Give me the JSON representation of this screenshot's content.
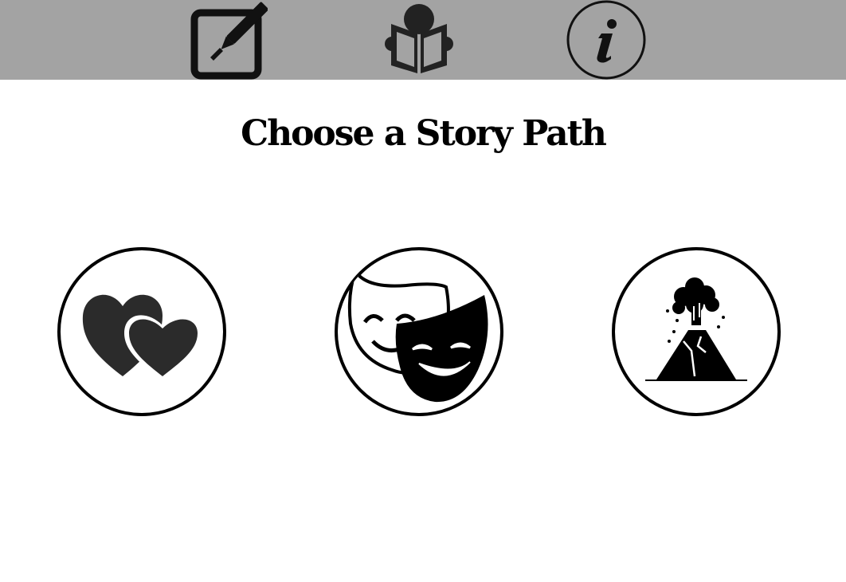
{
  "toolbar": {
    "buttons": [
      {
        "icon": "edit-icon"
      },
      {
        "icon": "reader-icon"
      },
      {
        "icon": "info-icon"
      }
    ],
    "background": "#a3a3a3"
  },
  "title": "Choose a Story Path",
  "story_paths": [
    {
      "icon": "hearts-icon"
    },
    {
      "icon": "theater-masks-icon"
    },
    {
      "icon": "volcano-icon"
    }
  ]
}
